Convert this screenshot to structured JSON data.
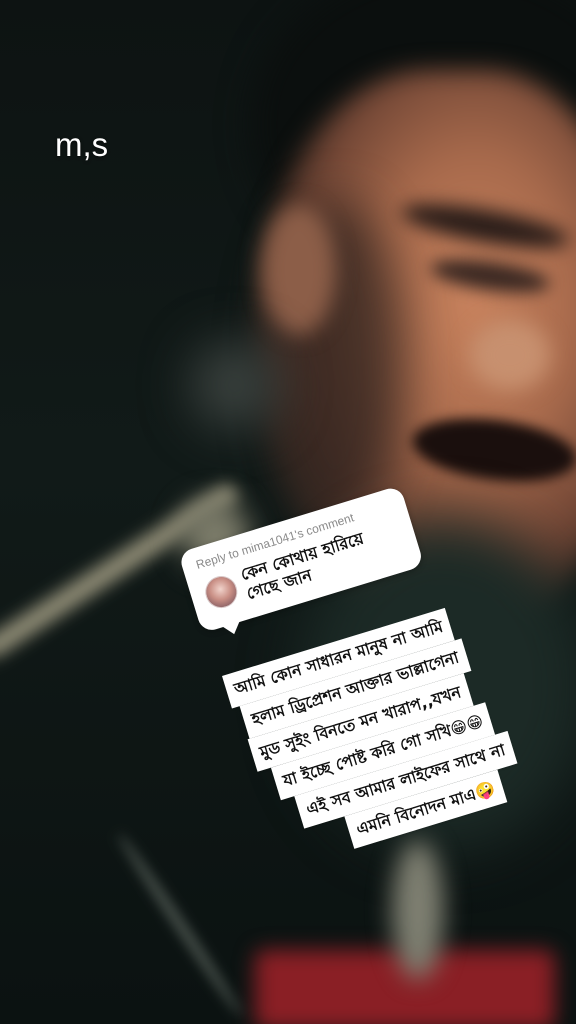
{
  "overlay": {
    "caption": "m,s"
  },
  "reply_sticker": {
    "header": "Reply to mima1041's comment",
    "comment": "কেন কোথায় হারিয়ে গেছে জান"
  },
  "caption_lines": [
    "আমি কোন সাধারন মানুষ না আমি",
    "হলাম ড্রিপ্রেশন আক্তার ভাল্লাগেনা",
    "মুড সুইং বিনতে মন খারাপ,,যখন",
    "যা ইচ্ছে পোষ্ট করি গো সখি😁😁",
    "এই সব আমার লাইফের সাথে না",
    "এমনি বিনোদন মাএ🤪"
  ]
}
